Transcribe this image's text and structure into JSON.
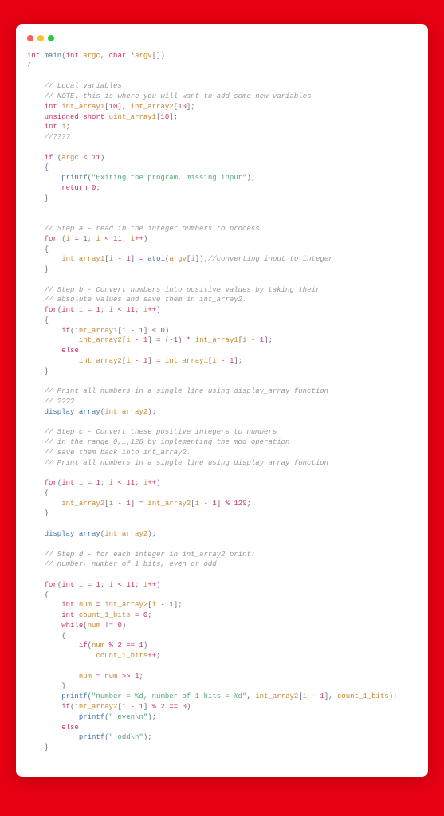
{
  "chart_data": null,
  "code": {
    "l1": {
      "t1": "int",
      "t2": "main",
      "t3": "int",
      "t4": "argc",
      "t5": "char",
      "t6": "argv"
    },
    "l2": {
      "t1": "{"
    },
    "l4": {
      "c": "// Local variables"
    },
    "l5": {
      "c": "// NOTE: this is where you will want to add some new variables"
    },
    "l6": {
      "t1": "int",
      "t2": "int_array1",
      "n1": "10",
      "t3": "int_array2",
      "n2": "10"
    },
    "l7": {
      "t1": "unsigned",
      "t2": "short",
      "t3": "uint_array1",
      "n1": "10"
    },
    "l8": {
      "t1": "int",
      "t2": "i"
    },
    "l9": {
      "c": "//????"
    },
    "l11": {
      "t1": "if",
      "t2": "argc",
      "op": "<",
      "n1": "11"
    },
    "l12": {
      "t1": "{"
    },
    "l13": {
      "t1": "printf",
      "s": "\"Exiting the program, missing input\""
    },
    "l14": {
      "t1": "return",
      "n1": "0"
    },
    "l15": {
      "t1": "}"
    },
    "l18": {
      "c": "// Step a - read in the integer numbers to process"
    },
    "l19": {
      "t1": "for",
      "t2": "i",
      "op1": "=",
      "n1": "1",
      "t3": "i",
      "op2": "<",
      "n2": "11",
      "t4": "i",
      "op3": "++"
    },
    "l20": {
      "t1": "{"
    },
    "l21": {
      "t1": "int_array1",
      "t2": "i",
      "op": "-",
      "n1": "1",
      "op2": "=",
      "t3": "atoi",
      "t4": "argv",
      "t5": "i",
      "c": "//converting input to integer"
    },
    "l22": {
      "t1": "}"
    },
    "l24": {
      "c": "// Step b - Convert numbers into positive values by taking their"
    },
    "l25": {
      "c": "// absolute values and save them in int_array2."
    },
    "l26": {
      "t1": "for",
      "t2": "int",
      "t3": "i",
      "op1": "=",
      "n1": "1",
      "t4": "i",
      "op2": "<",
      "n2": "11",
      "t5": "i",
      "op3": "++"
    },
    "l27": {
      "t1": "{"
    },
    "l28": {
      "t1": "if",
      "t2": "int_array1",
      "t3": "i",
      "op": "-",
      "n1": "1",
      "op2": "<",
      "n2": "0"
    },
    "l29": {
      "t1": "int_array2",
      "t2": "i",
      "op": "-",
      "n1": "1",
      "op2": "=",
      "n2": "-1",
      "op3": "*",
      "t3": "int_array1",
      "t4": "i",
      "op4": "-",
      "n3": "1"
    },
    "l30": {
      "t1": "else"
    },
    "l31": {
      "t1": "int_array2",
      "t2": "i",
      "op": "-",
      "n1": "1",
      "op2": "=",
      "t3": "int_array1",
      "t4": "i",
      "op3": "-",
      "n2": "1"
    },
    "l32": {
      "t1": "}"
    },
    "l34": {
      "c": "// Print all numbers in a single line using display_array function"
    },
    "l35": {
      "c": "// ????"
    },
    "l36": {
      "t1": "display_array",
      "t2": "int_array2"
    },
    "l38": {
      "c": "// Step c - Convert these positive integers to numbers"
    },
    "l39": {
      "c": "// in the range 0,…,128 by implementing the mod operation"
    },
    "l40": {
      "c": "// save them back into int_array2."
    },
    "l41": {
      "c": "// Print all numbers in a single line using display_array function"
    },
    "l43": {
      "t1": "for",
      "t2": "int",
      "t3": "i",
      "op1": "=",
      "n1": "1",
      "t4": "i",
      "op2": "<",
      "n2": "11",
      "t5": "i",
      "op3": "++"
    },
    "l44": {
      "t1": "{"
    },
    "l45": {
      "t1": "int_array2",
      "t2": "i",
      "op": "-",
      "n1": "1",
      "op2": "=",
      "t3": "int_array2",
      "t4": "i",
      "op3": "-",
      "n2": "1",
      "op4": "%",
      "n3": "129"
    },
    "l46": {
      "t1": "}"
    },
    "l48": {
      "t1": "display_array",
      "t2": "int_array2"
    },
    "l50": {
      "c": "// Step d - for each integer in int_array2 print:"
    },
    "l51": {
      "c": "// number, number of 1 bits, even or odd"
    },
    "l53": {
      "t1": "for",
      "t2": "int",
      "t3": "i",
      "op1": "=",
      "n1": "1",
      "t4": "i",
      "op2": "<",
      "n2": "11",
      "t5": "i",
      "op3": "++"
    },
    "l54": {
      "t1": "{"
    },
    "l55": {
      "t1": "int",
      "t2": "num",
      "op": "=",
      "t3": "int_array2",
      "t4": "i",
      "op2": "-",
      "n1": "1"
    },
    "l56": {
      "t1": "int",
      "t2": "count_1_bits",
      "op": "=",
      "n1": "0"
    },
    "l57": {
      "t1": "while",
      "t2": "num",
      "op": "!=",
      "n1": "0"
    },
    "l58": {
      "t1": "{"
    },
    "l59": {
      "t1": "if",
      "t2": "num",
      "op": "%",
      "n1": "2",
      "op2": "==",
      "n2": "1"
    },
    "l60": {
      "t1": "count_1_bits",
      "op": "++"
    },
    "l62": {
      "t1": "num",
      "op": "=",
      "t2": "num",
      "op2": ">>",
      "n1": "1"
    },
    "l63": {
      "t1": "}"
    },
    "l64": {
      "t1": "printf",
      "s": "\"number = %d, number of 1 bits = %d\"",
      "t2": "int_array2",
      "t3": "i",
      "op": "-",
      "n1": "1",
      "t4": "count_1_bits"
    },
    "l65": {
      "t1": "if",
      "t2": "int_array2",
      "t3": "i",
      "op": "-",
      "n1": "1",
      "op2": "%",
      "n2": "2",
      "op3": "==",
      "n3": "0"
    },
    "l66": {
      "t1": "printf",
      "s": "\" even\\n\""
    },
    "l67": {
      "t1": "else"
    },
    "l68": {
      "t1": "printf",
      "s": "\" odd\\n\""
    },
    "l69": {
      "t1": "}"
    }
  }
}
